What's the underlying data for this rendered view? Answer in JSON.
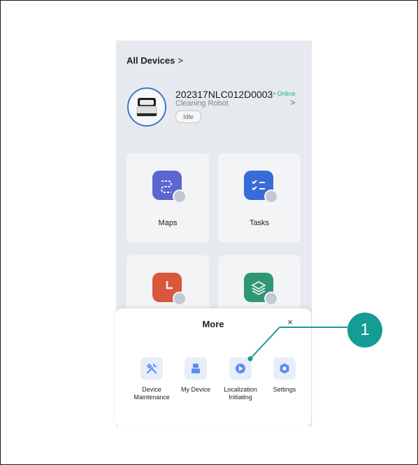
{
  "header": {
    "title": "All Devices",
    "chevron": ">"
  },
  "device": {
    "id": "202317NLC012D0003",
    "status": "• Online",
    "type": "Cleaning Robot",
    "state": "Idle",
    "chevron": ">"
  },
  "cards": [
    {
      "label": "Maps",
      "icon": "maps-icon",
      "color": "#5e6ad8"
    },
    {
      "label": "Tasks",
      "icon": "tasks-icon",
      "color": "#3b6fe0"
    },
    {
      "label": "",
      "icon": "clock-icon",
      "color": "#e05a3f"
    },
    {
      "label": "",
      "icon": "layers-icon",
      "color": "#2f9c7a"
    }
  ],
  "sheet": {
    "title": "More",
    "close": "×",
    "items": [
      {
        "label": "Device\nMaintenance",
        "icon": "wrench-icon"
      },
      {
        "label": "My Device",
        "icon": "device-icon"
      },
      {
        "label": "Localization\nInitiating",
        "icon": "location-icon"
      },
      {
        "label": "Settings",
        "icon": "settings-icon"
      }
    ]
  },
  "callout": {
    "number": "1",
    "color": "#149c95"
  },
  "colors": {
    "accent": "#3f79d8",
    "icon_tint": "#5b8ef0",
    "online": "#2bb673"
  }
}
